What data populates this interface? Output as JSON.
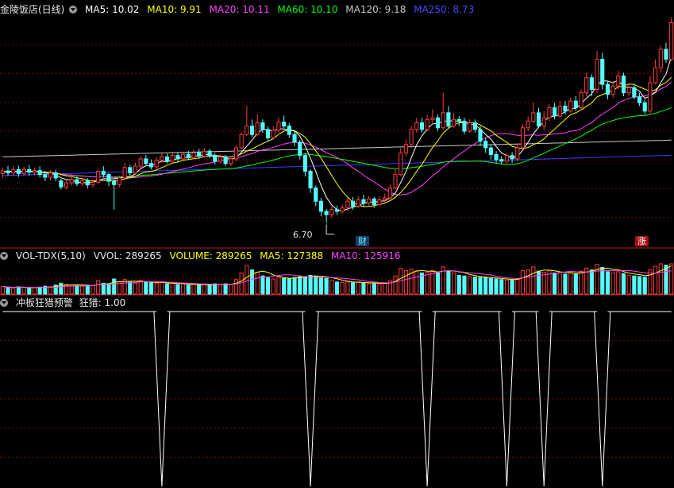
{
  "colors": {
    "up": "#ff3c3c",
    "down": "#54ffff",
    "grid": "#7a0000",
    "border": "#c02020",
    "ma5": "#ffffff",
    "ma10": "#ffff00",
    "ma20": "#ff40ff",
    "ma60": "#00ff00",
    "ma120": "#c8c8c8",
    "ma250": "#3c3cff",
    "vol_ma5": "#ffff00",
    "vol_ma10": "#ff40ff",
    "signal": "#ffffff"
  },
  "main_header": {
    "title": "金陵饭店(日线)",
    "ma5": "MA5: 10.02",
    "ma10": "MA10: 9.91",
    "ma20": "MA20: 10.11",
    "ma60": "MA60: 10.10",
    "ma120": "MA120: 9.18",
    "ma250": "MA250: 8.73"
  },
  "vol_header": {
    "name": "VOL-TDX(5,10)",
    "vvol": "VVOL: 289265",
    "volume": "VOLUME: 289265",
    "ma5": "MA5: 127388",
    "ma10": "MA10: 125916"
  },
  "ind_header": {
    "name": "冲板狂猎预警",
    "value": "狂猎: 1.00"
  },
  "annotations": {
    "low_label": "6.70",
    "tag_cai": "财",
    "tag_zhang": "涨"
  },
  "chart_data": [
    {
      "type": "candlestick",
      "title": "金陵饭店(日线)",
      "ylim": [
        6.0,
        12.9
      ],
      "low_marker": 6.7,
      "candles": [
        [
          8.18,
          8.26,
          8.36,
          8.04,
          25
        ],
        [
          8.26,
          8.2,
          8.41,
          8.1,
          22
        ],
        [
          8.2,
          8.3,
          8.4,
          8.1,
          20
        ],
        [
          8.3,
          8.18,
          8.42,
          8.08,
          24
        ],
        [
          8.18,
          8.3,
          8.38,
          8.1,
          22
        ],
        [
          8.3,
          8.22,
          8.44,
          8.12,
          20
        ],
        [
          8.22,
          8.27,
          8.36,
          8.13,
          21
        ],
        [
          8.27,
          8.15,
          8.4,
          8.06,
          23
        ],
        [
          8.15,
          8.07,
          8.26,
          7.95,
          26
        ],
        [
          8.07,
          8.2,
          8.28,
          7.98,
          24
        ],
        [
          8.2,
          8.05,
          8.3,
          7.95,
          30
        ],
        [
          7.96,
          7.78,
          8.02,
          7.7,
          36
        ],
        [
          7.78,
          7.9,
          8.0,
          7.7,
          32
        ],
        [
          7.9,
          8.0,
          8.08,
          7.82,
          30
        ],
        [
          8.0,
          7.88,
          8.1,
          7.8,
          28
        ],
        [
          7.88,
          7.96,
          8.06,
          7.8,
          26
        ],
        [
          7.96,
          7.84,
          8.04,
          7.74,
          30
        ],
        [
          7.84,
          7.92,
          8.0,
          7.76,
          28
        ],
        [
          7.92,
          8.25,
          8.3,
          7.86,
          45
        ],
        [
          8.25,
          8.15,
          8.4,
          8.06,
          36
        ],
        [
          8.15,
          7.95,
          8.2,
          7.8,
          34
        ],
        [
          7.95,
          7.85,
          8.0,
          7.1,
          50
        ],
        [
          7.85,
          8.05,
          8.12,
          7.78,
          40
        ],
        [
          8.05,
          8.36,
          8.5,
          8.0,
          48
        ],
        [
          8.36,
          8.2,
          8.44,
          8.1,
          40
        ],
        [
          8.2,
          8.4,
          8.5,
          8.14,
          36
        ],
        [
          8.4,
          8.62,
          8.7,
          8.32,
          45
        ],
        [
          8.62,
          8.48,
          8.74,
          8.4,
          40
        ],
        [
          8.48,
          8.38,
          8.6,
          8.3,
          38
        ],
        [
          8.38,
          8.58,
          8.66,
          8.3,
          36
        ],
        [
          8.58,
          8.68,
          8.78,
          8.5,
          38
        ],
        [
          8.68,
          8.55,
          8.78,
          8.48,
          34
        ],
        [
          8.55,
          8.72,
          8.8,
          8.5,
          36
        ],
        [
          8.72,
          8.62,
          8.82,
          8.52,
          32
        ],
        [
          8.62,
          8.76,
          8.84,
          8.55,
          34
        ],
        [
          8.76,
          8.65,
          8.86,
          8.58,
          30
        ],
        [
          8.65,
          8.8,
          8.9,
          8.6,
          32
        ],
        [
          8.8,
          8.7,
          8.92,
          8.62,
          30
        ],
        [
          8.7,
          8.85,
          8.95,
          8.66,
          32
        ],
        [
          8.85,
          8.72,
          8.92,
          8.64,
          30
        ],
        [
          8.72,
          8.55,
          8.8,
          8.45,
          34
        ],
        [
          8.55,
          8.68,
          8.76,
          8.48,
          32
        ],
        [
          8.68,
          8.48,
          8.74,
          8.4,
          34
        ],
        [
          8.48,
          8.62,
          8.7,
          8.4,
          32
        ],
        [
          8.62,
          8.95,
          9.02,
          8.55,
          48
        ],
        [
          8.95,
          9.35,
          9.4,
          8.9,
          70
        ],
        [
          9.35,
          9.6,
          10.2,
          9.3,
          95
        ],
        [
          9.6,
          9.35,
          9.8,
          9.28,
          80
        ],
        [
          9.35,
          9.7,
          9.95,
          9.3,
          72
        ],
        [
          9.7,
          9.5,
          9.8,
          9.4,
          60
        ],
        [
          9.5,
          9.25,
          9.6,
          9.15,
          54
        ],
        [
          9.25,
          9.48,
          9.6,
          9.2,
          50
        ],
        [
          9.48,
          9.72,
          9.85,
          9.4,
          56
        ],
        [
          9.72,
          9.6,
          9.92,
          9.5,
          52
        ],
        [
          9.6,
          9.35,
          9.7,
          9.25,
          50
        ],
        [
          9.35,
          9.12,
          9.45,
          9.0,
          55
        ],
        [
          9.12,
          8.72,
          9.18,
          8.6,
          60
        ],
        [
          8.72,
          8.25,
          8.8,
          8.1,
          58
        ],
        [
          8.25,
          7.75,
          8.3,
          7.6,
          62
        ],
        [
          7.75,
          7.35,
          7.82,
          7.2,
          60
        ],
        [
          7.35,
          7.05,
          7.45,
          6.9,
          55
        ],
        [
          7.05,
          6.95,
          7.12,
          6.7,
          52
        ],
        [
          6.95,
          7.1,
          7.2,
          6.85,
          45
        ],
        [
          7.1,
          7.05,
          7.22,
          6.95,
          40
        ],
        [
          7.05,
          7.15,
          7.25,
          6.98,
          38
        ],
        [
          7.15,
          7.35,
          7.45,
          7.05,
          40
        ],
        [
          7.35,
          7.2,
          7.48,
          7.1,
          38
        ],
        [
          7.2,
          7.4,
          7.5,
          7.15,
          40
        ],
        [
          7.4,
          7.3,
          7.55,
          7.2,
          36
        ],
        [
          7.3,
          7.42,
          7.5,
          7.22,
          34
        ],
        [
          7.42,
          7.25,
          7.48,
          7.15,
          36
        ],
        [
          7.25,
          7.4,
          7.5,
          7.2,
          34
        ],
        [
          7.4,
          7.45,
          7.58,
          7.3,
          36
        ],
        [
          7.45,
          7.75,
          7.85,
          7.4,
          44
        ],
        [
          7.75,
          8.15,
          8.3,
          7.7,
          60
        ],
        [
          8.15,
          8.8,
          8.95,
          8.1,
          85
        ],
        [
          8.8,
          9.05,
          9.2,
          8.7,
          78
        ],
        [
          9.05,
          9.5,
          9.6,
          8.95,
          82
        ],
        [
          9.5,
          9.7,
          9.85,
          9.4,
          76
        ],
        [
          9.7,
          9.5,
          9.85,
          9.4,
          70
        ],
        [
          9.5,
          9.8,
          9.95,
          9.45,
          72
        ],
        [
          9.8,
          9.85,
          10.1,
          9.7,
          78
        ],
        [
          9.85,
          9.55,
          9.95,
          9.45,
          70
        ],
        [
          9.55,
          10.0,
          10.6,
          9.5,
          90
        ],
        [
          10.0,
          9.6,
          10.2,
          9.55,
          75
        ],
        [
          9.6,
          9.8,
          10.0,
          9.55,
          70
        ],
        [
          9.8,
          9.75,
          9.9,
          9.6,
          62
        ],
        [
          9.75,
          9.45,
          9.85,
          9.35,
          60
        ],
        [
          9.45,
          9.7,
          9.8,
          9.4,
          58
        ],
        [
          9.7,
          9.5,
          9.8,
          9.4,
          56
        ],
        [
          9.5,
          9.15,
          9.6,
          9.0,
          55
        ],
        [
          9.15,
          8.95,
          9.25,
          8.8,
          54
        ],
        [
          8.95,
          8.75,
          9.05,
          8.6,
          52
        ],
        [
          8.75,
          8.6,
          8.85,
          8.5,
          50
        ],
        [
          8.6,
          8.55,
          8.7,
          8.45,
          48
        ],
        [
          8.55,
          8.72,
          8.8,
          8.48,
          46
        ],
        [
          8.72,
          8.62,
          8.82,
          8.5,
          46
        ],
        [
          8.62,
          8.95,
          9.05,
          8.55,
          52
        ],
        [
          8.95,
          9.55,
          9.65,
          8.9,
          78
        ],
        [
          9.55,
          9.75,
          9.9,
          9.45,
          80
        ],
        [
          9.75,
          10.0,
          10.3,
          9.7,
          90
        ],
        [
          10.0,
          9.6,
          10.15,
          9.55,
          76
        ],
        [
          9.6,
          9.85,
          10.05,
          9.5,
          72
        ],
        [
          9.85,
          10.15,
          10.25,
          9.75,
          78
        ],
        [
          10.15,
          9.9,
          10.3,
          9.8,
          70
        ],
        [
          9.9,
          10.2,
          10.35,
          9.85,
          72
        ],
        [
          10.2,
          10.05,
          10.35,
          9.95,
          66
        ],
        [
          10.05,
          10.35,
          10.45,
          10.0,
          70
        ],
        [
          10.35,
          10.15,
          10.5,
          10.05,
          66
        ],
        [
          10.15,
          10.6,
          10.7,
          10.1,
          76
        ],
        [
          10.6,
          11.05,
          11.2,
          10.5,
          86
        ],
        [
          11.05,
          10.7,
          11.15,
          10.5,
          80
        ],
        [
          10.7,
          11.6,
          11.85,
          10.6,
          98
        ],
        [
          11.6,
          10.85,
          11.8,
          10.7,
          88
        ],
        [
          10.85,
          10.55,
          10.95,
          10.4,
          74
        ],
        [
          10.55,
          10.8,
          10.95,
          10.45,
          70
        ],
        [
          10.8,
          11.1,
          11.25,
          10.7,
          74
        ],
        [
          11.1,
          10.6,
          11.2,
          10.5,
          68
        ],
        [
          10.6,
          10.75,
          10.85,
          10.5,
          62
        ],
        [
          10.75,
          10.48,
          10.85,
          10.4,
          60
        ],
        [
          10.48,
          10.3,
          10.6,
          10.2,
          58
        ],
        [
          10.3,
          10.05,
          10.4,
          9.95,
          56
        ],
        [
          10.05,
          10.9,
          11.1,
          9.98,
          80
        ],
        [
          10.9,
          11.35,
          11.6,
          10.85,
          92
        ],
        [
          11.35,
          11.9,
          12.0,
          11.2,
          100
        ],
        [
          11.9,
          11.6,
          12.1,
          11.5,
          96
        ],
        [
          11.6,
          12.7,
          12.85,
          11.55,
          100
        ]
      ],
      "ma": {
        "ma5": 10.02,
        "ma10": 9.91,
        "ma20": 10.11,
        "ma60": 10.1,
        "ma120": 9.18,
        "ma250": 8.73
      }
    },
    {
      "type": "bar",
      "title": "VOL-TDX(5,10)",
      "series": [
        {
          "name": "VVOL"
        },
        {
          "name": "MA5"
        },
        {
          "name": "MA10"
        }
      ],
      "last_values": {
        "vvol": 289265,
        "volume": 289265,
        "ma5": 127388,
        "ma10": 125916
      }
    },
    {
      "type": "line",
      "title": "冲板狂猎预警",
      "series": [
        {
          "name": "狂猎"
        }
      ],
      "baseline": 1.0,
      "signal_index": [
        30,
        58,
        80,
        95,
        102,
        113
      ],
      "ylim": [
        0,
        1
      ]
    }
  ]
}
